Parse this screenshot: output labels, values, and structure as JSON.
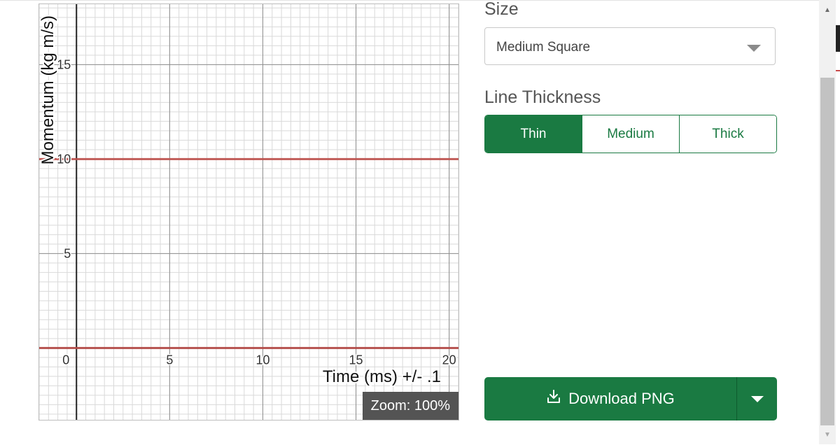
{
  "graph": {
    "x_axis_label": "Time (ms) +/- .1",
    "y_axis_label": "Momentum (kg m/s)",
    "x_ticks": [
      "0",
      "5",
      "10",
      "15",
      "20"
    ],
    "y_ticks": [
      "15",
      "10",
      "5"
    ],
    "zoom_label": "Zoom: 100%",
    "line_color": "#c0504d"
  },
  "chart_data": {
    "type": "line",
    "title": "",
    "xlabel": "Time (ms) +/- .1",
    "ylabel": "Momentum (kg m/s)",
    "xlim": [
      -2,
      20.5
    ],
    "ylim": [
      -3.8,
      18.2
    ],
    "grid": true,
    "series": [
      {
        "x": [
          -2,
          20.5
        ],
        "values": [
          10,
          10
        ]
      },
      {
        "x": [
          -2,
          20.5
        ],
        "values": [
          0,
          0
        ]
      }
    ]
  },
  "settings": {
    "size_label": "Size",
    "size_value": "Medium Square",
    "thickness_label": "Line Thickness",
    "thickness_options": [
      "Thin",
      "Medium",
      "Thick"
    ],
    "thickness_selected": "Thin",
    "download_label": "Download PNG"
  },
  "icons": {
    "download": "download-icon",
    "select_caret": "chevron-down-icon",
    "split_caret": "chevron-down-icon"
  },
  "colors": {
    "accent": "#1a7a42",
    "zoom_badge": "#545454"
  }
}
